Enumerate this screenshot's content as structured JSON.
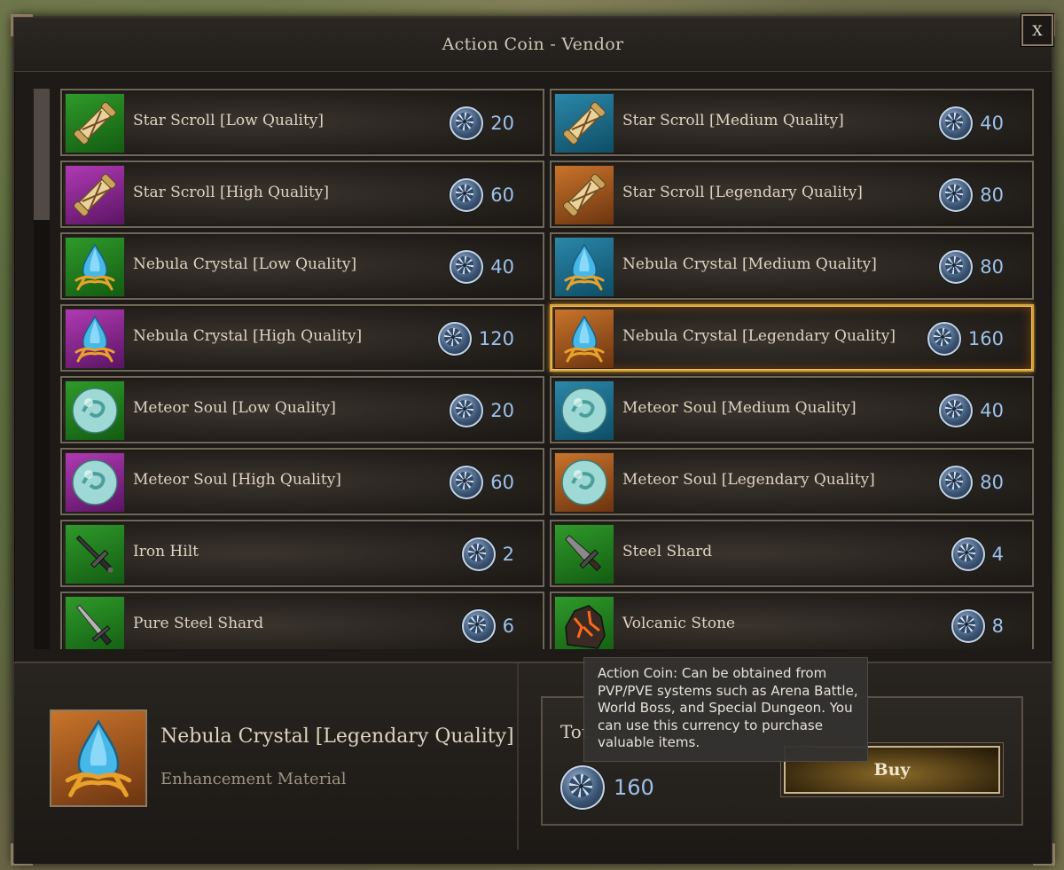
{
  "window": {
    "title": "Action Coin - Vendor",
    "close_label": "X"
  },
  "items": [
    {
      "name": "Star Scroll [Low Quality]",
      "price": "20",
      "icon": "scroll-icon",
      "quality": "low"
    },
    {
      "name": "Star Scroll [Medium Quality]",
      "price": "40",
      "icon": "scroll-icon",
      "quality": "med"
    },
    {
      "name": "Star Scroll [High Quality]",
      "price": "60",
      "icon": "scroll-icon",
      "quality": "high"
    },
    {
      "name": "Star Scroll [Legendary Quality]",
      "price": "80",
      "icon": "scroll-icon",
      "quality": "leg"
    },
    {
      "name": "Nebula Crystal [Low Quality]",
      "price": "40",
      "icon": "crystal-icon",
      "quality": "low"
    },
    {
      "name": "Nebula Crystal [Medium Quality]",
      "price": "80",
      "icon": "crystal-icon",
      "quality": "med"
    },
    {
      "name": "Nebula Crystal [High Quality]",
      "price": "120",
      "icon": "crystal-icon",
      "quality": "high"
    },
    {
      "name": "Nebula Crystal [Legendary Quality]",
      "price": "160",
      "icon": "crystal-icon",
      "quality": "leg",
      "selected": true
    },
    {
      "name": "Meteor Soul [Low Quality]",
      "price": "20",
      "icon": "orb-icon",
      "quality": "low"
    },
    {
      "name": "Meteor Soul [Medium Quality]",
      "price": "40",
      "icon": "orb-icon",
      "quality": "med"
    },
    {
      "name": "Meteor Soul [High Quality]",
      "price": "60",
      "icon": "orb-icon",
      "quality": "high"
    },
    {
      "name": "Meteor Soul [Legendary Quality]",
      "price": "80",
      "icon": "orb-icon",
      "quality": "leg"
    },
    {
      "name": "Iron Hilt",
      "price": "2",
      "icon": "hilt-icon",
      "quality": "low"
    },
    {
      "name": "Steel Shard",
      "price": "4",
      "icon": "shard-icon",
      "quality": "low"
    },
    {
      "name": "Pure Steel Shard",
      "price": "6",
      "icon": "sword-icon",
      "quality": "low"
    },
    {
      "name": "Volcanic Stone",
      "price": "8",
      "icon": "stone-icon",
      "quality": "low"
    }
  ],
  "selected": {
    "name": "Nebula Crystal [Legendary Quality]",
    "type": "Enhancement Material",
    "icon": "crystal-icon"
  },
  "purchase": {
    "total_label": "Tot",
    "total_price": "160",
    "buy_label": "Buy"
  },
  "tooltip": {
    "text": "Action Coin: Can be obtained from PVP/PVE systems such as Arena Battle, World Boss, and Special Dungeon. You can use this currency to purchase valuable items."
  },
  "colors": {
    "quality_low": "#2f9a2a",
    "quality_medium": "#2b87a9",
    "quality_high": "#b03ab3",
    "quality_legendary": "#c9742b",
    "price_text": "#9cc2ec",
    "selected_border": "#d7a23a"
  }
}
